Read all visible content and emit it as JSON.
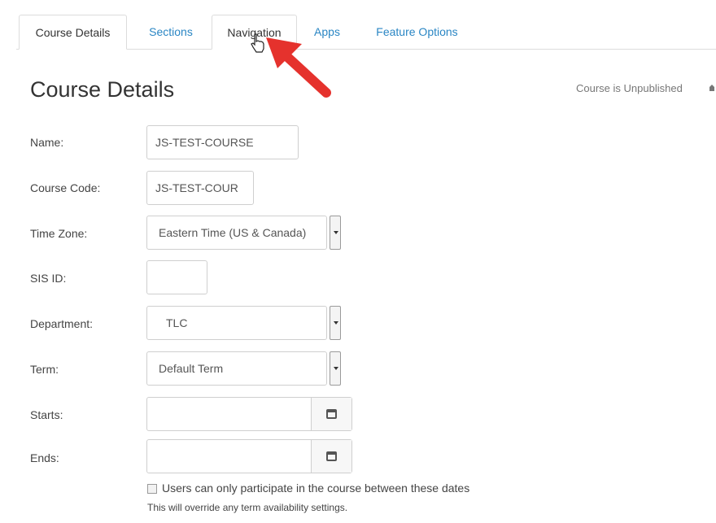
{
  "tabs": [
    {
      "label": "Course Details",
      "active": true
    },
    {
      "label": "Sections",
      "active": false
    },
    {
      "label": "Navigation",
      "active": false
    },
    {
      "label": "Apps",
      "active": false
    },
    {
      "label": "Feature Options",
      "active": false
    }
  ],
  "page_title": "Course Details",
  "status": "Course is Unpublished",
  "form": {
    "name": {
      "label": "Name:",
      "value": "JS-TEST-COURSE"
    },
    "course_code": {
      "label": "Course Code:",
      "value": "JS-TEST-COUR"
    },
    "time_zone": {
      "label": "Time Zone:",
      "value": "Eastern Time (US & Canada)"
    },
    "sis_id": {
      "label": "SIS ID:",
      "value": ""
    },
    "department": {
      "label": "Department:",
      "value": "TLC"
    },
    "term": {
      "label": "Term:",
      "value": "Default Term"
    },
    "starts": {
      "label": "Starts:",
      "value": ""
    },
    "ends": {
      "label": "Ends:",
      "value": ""
    },
    "restrict_dates": {
      "label": "Users can only participate in the course between these dates",
      "checked": false
    },
    "note": "This will override any term availability settings."
  },
  "colors": {
    "link": "#2a86c4",
    "arrow": "#e5322d"
  },
  "icons": [
    "calendar-icon",
    "pointer-cursor-icon",
    "red-arrow-annotation"
  ]
}
